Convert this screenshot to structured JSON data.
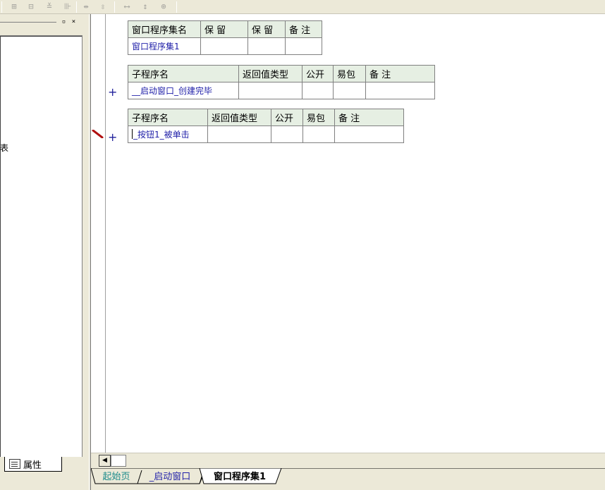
{
  "toolbar": {
    "icons": [
      "align-left-icon",
      "align-center-icon",
      "align-right-icon",
      "align-grid-icon",
      "space-horizontal-icon",
      "space-vertical-icon",
      "same-width-icon",
      "same-height-icon",
      "same-size-icon"
    ]
  },
  "left_panel": {
    "partial_text": "表",
    "property_tab_label": "属性"
  },
  "table_set": {
    "headers": [
      "窗口程序集名",
      "保 留",
      "保 留",
      "备 注"
    ],
    "values": [
      "窗口程序集1",
      "",
      "",
      ""
    ]
  },
  "table_sub1": {
    "headers": [
      "子程序名",
      "返回值类型",
      "公开",
      "易包",
      "备 注"
    ],
    "values": [
      "__启动窗口_创建完毕",
      "",
      "",
      "",
      ""
    ]
  },
  "table_sub2": {
    "headers": [
      "子程序名",
      "返回值类型",
      "公开",
      "易包",
      "备 注"
    ],
    "values": [
      "_按钮1_被单击",
      "",
      "",
      "",
      ""
    ]
  },
  "gutter": {
    "plus1": "+",
    "plus2": "+"
  },
  "doc_tabs": {
    "start": "起始页",
    "boot_window": "_启动窗口",
    "active": "窗口程序集1"
  },
  "colors": {
    "header_bg": "#e6efe3",
    "value_text": "#1f1fa8",
    "start_tab_text": "#1a8a8a",
    "chrome": "#ece9d8"
  }
}
